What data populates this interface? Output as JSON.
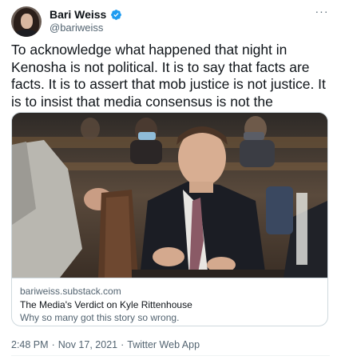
{
  "author": {
    "display_name": "Bari Weiss",
    "handle": "@bariweiss",
    "verified_icon": "verified-badge-icon",
    "verified_color": "#1d9bf0"
  },
  "more_icon": "more-horizontal-icon",
  "more_label": "···",
  "tweet": {
    "text": "To acknowledge what happened that night in Kenosha is not political. It is to say that facts are facts. It is to assert that mob justice is not justice. It is to insist that media consensus is not the equivalent of due process."
  },
  "link_card": {
    "image": "courtroom-photo",
    "domain": "bariweiss.substack.com",
    "title": "The Media's Verdict on Kyle Rittenhouse",
    "description": "Why so many got this story so wrong."
  },
  "meta": {
    "time": "2:48 PM",
    "separator": "·",
    "date": "Nov 17, 2021",
    "source": "Twitter Web App"
  },
  "colors": {
    "text_primary": "#0f1419",
    "text_secondary": "#536471",
    "border": "#cfd9de",
    "accent": "#1d9bf0"
  }
}
